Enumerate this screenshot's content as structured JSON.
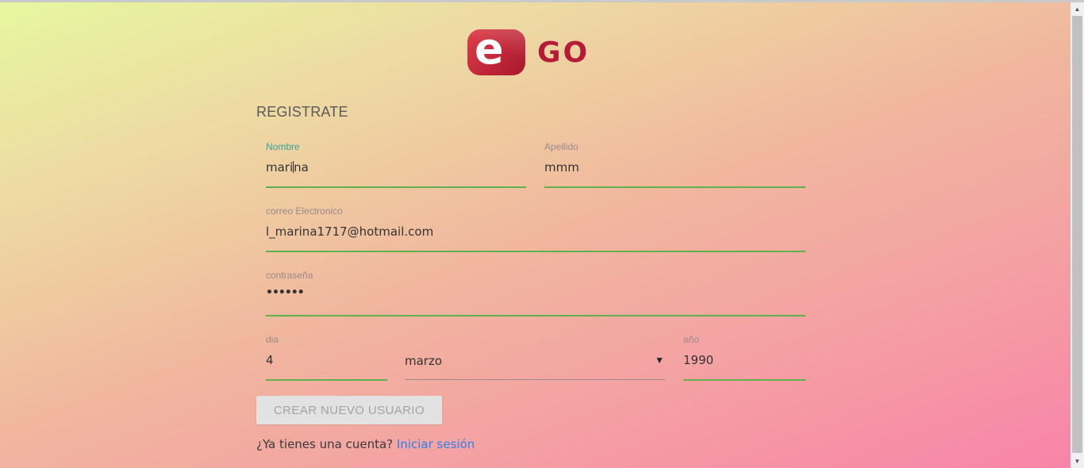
{
  "logo": {
    "mark_letter": "e",
    "brand_text": "GO"
  },
  "form": {
    "heading": "REGISTRATE",
    "nombre": {
      "label": "Nombre",
      "value_before_caret": "mari",
      "value_after_caret": "na"
    },
    "apellido": {
      "label": "Apellido",
      "value": "mmm"
    },
    "correo": {
      "label": "correo Electronico",
      "value": "l_marina1717@hotmail.com"
    },
    "password": {
      "label": "contraseña",
      "value": "••••••"
    },
    "dia": {
      "label": "dia",
      "value": "4"
    },
    "mes": {
      "value": "marzo",
      "chevron": "▼"
    },
    "anio": {
      "label": "año",
      "value": "1990"
    },
    "submit_label": "CREAR NUEVO USUARIO",
    "login_prompt": "¿Ya tienes una cuenta?",
    "login_link": "Iniciar sesión"
  },
  "colors": {
    "accent_focus": "#3aa39a",
    "underline": "#5fb04f",
    "link": "#2f80ed",
    "brand": "#b51a36"
  },
  "icons": {
    "scroll_up": "▲",
    "scroll_down": "▼"
  }
}
